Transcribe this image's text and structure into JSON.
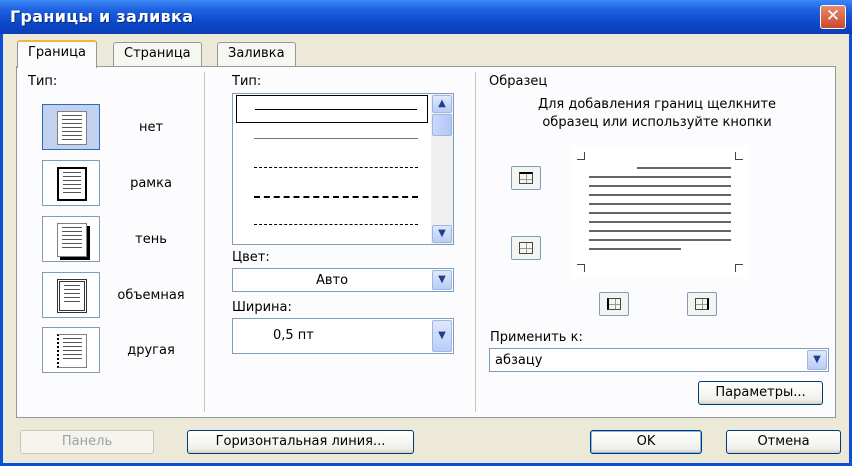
{
  "window": {
    "title": "Границы и заливка",
    "close_glyph": "✕"
  },
  "tabs": [
    {
      "label": "Граница",
      "active": true
    },
    {
      "label": "Страница",
      "active": false
    },
    {
      "label": "Заливка",
      "active": false
    }
  ],
  "setting": {
    "label": "Тип:",
    "items": [
      {
        "label": "нет",
        "selected": true
      },
      {
        "label": "рамка",
        "selected": false
      },
      {
        "label": "тень",
        "selected": false
      },
      {
        "label": "объемная",
        "selected": false
      },
      {
        "label": "другая",
        "selected": false
      }
    ]
  },
  "style": {
    "label": "Тип:",
    "items": [
      "solid",
      "thin",
      "dash-small",
      "dash",
      "dash-dot"
    ]
  },
  "color": {
    "label": "Цвет:",
    "value": "Авто"
  },
  "width": {
    "label": "Ширина:",
    "value": "0,5 пт"
  },
  "preview": {
    "label": "Образец",
    "hint_line1": "Для добавления границ щелкните",
    "hint_line2": "образец или используйте кнопки"
  },
  "apply_to": {
    "label": "Применить к:",
    "value": "абзацу"
  },
  "buttons": {
    "options": "Параметры...",
    "toolbar": "Панель",
    "horizontal_line": "Горизонтальная линия...",
    "ok": "OK",
    "cancel": "Отмена"
  }
}
